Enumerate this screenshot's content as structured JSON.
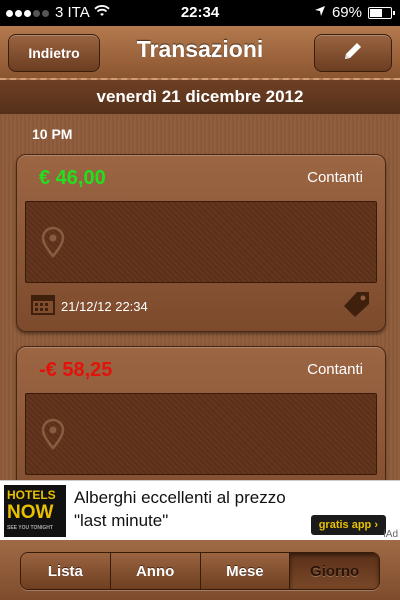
{
  "status_bar": {
    "carrier": "3 ITA",
    "time": "22:34",
    "battery": "69%",
    "signal_bars": 3,
    "battery_level": 0.69
  },
  "nav": {
    "back_label": "Indietro",
    "title": "Transazioni",
    "edit_icon": "pencil-icon"
  },
  "date_header": "venerdì 21 dicembre 2012",
  "section": {
    "time_label": "10 PM"
  },
  "transactions": [
    {
      "amount": "€ 46,00",
      "amount_color": "#22e01e",
      "method": "Contanti",
      "timestamp": "21/12/12 22:34"
    },
    {
      "amount": "-€ 58,25",
      "amount_color": "#e3120b",
      "method": "Contanti",
      "timestamp": ""
    }
  ],
  "ad": {
    "logo_top": "HOTELS",
    "logo_bottom": "NOW",
    "logo_tagline": "SEE YOU TONIGHT",
    "text_line1": "Alberghi eccellenti al prezzo",
    "text_line2": "\"last minute\"",
    "cta": "gratis app ›",
    "badge": "iAd"
  },
  "tabs": [
    {
      "label": "Lista",
      "active": false
    },
    {
      "label": "Anno",
      "active": false
    },
    {
      "label": "Mese",
      "active": false
    },
    {
      "label": "Giorno",
      "active": true
    }
  ],
  "colors": {
    "leather": "#8e5c3b",
    "positive": "#22e01e",
    "negative": "#e3120b"
  }
}
